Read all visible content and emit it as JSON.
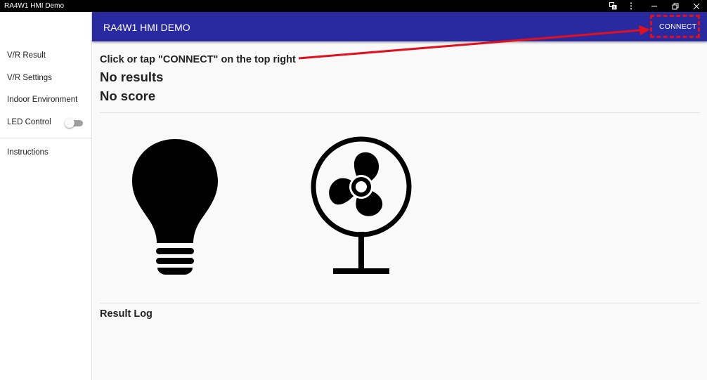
{
  "window": {
    "title": "RA4W1 HMI Demo",
    "controls": [
      "translate-icon",
      "more-icon",
      "minimize-icon",
      "restore-icon",
      "close-icon"
    ]
  },
  "appbar": {
    "title": "RA4W1 HMI DEMO",
    "connect_label": "CONNECT",
    "color": "#2a2aa0"
  },
  "sidebar": {
    "items": [
      {
        "label": "V/R Result"
      },
      {
        "label": "V/R Settings"
      },
      {
        "label": "Indoor Environment"
      },
      {
        "label": "LED Control",
        "toggle": "off"
      },
      {
        "label": "Instructions"
      }
    ]
  },
  "main": {
    "hint": "Click or tap \"CONNECT\" on the top right",
    "results": "No results",
    "score": "No score",
    "icons": [
      "lightbulb-icon",
      "fan-icon"
    ],
    "log_title": "Result Log"
  },
  "annotation": {
    "color": "#e0101e"
  }
}
